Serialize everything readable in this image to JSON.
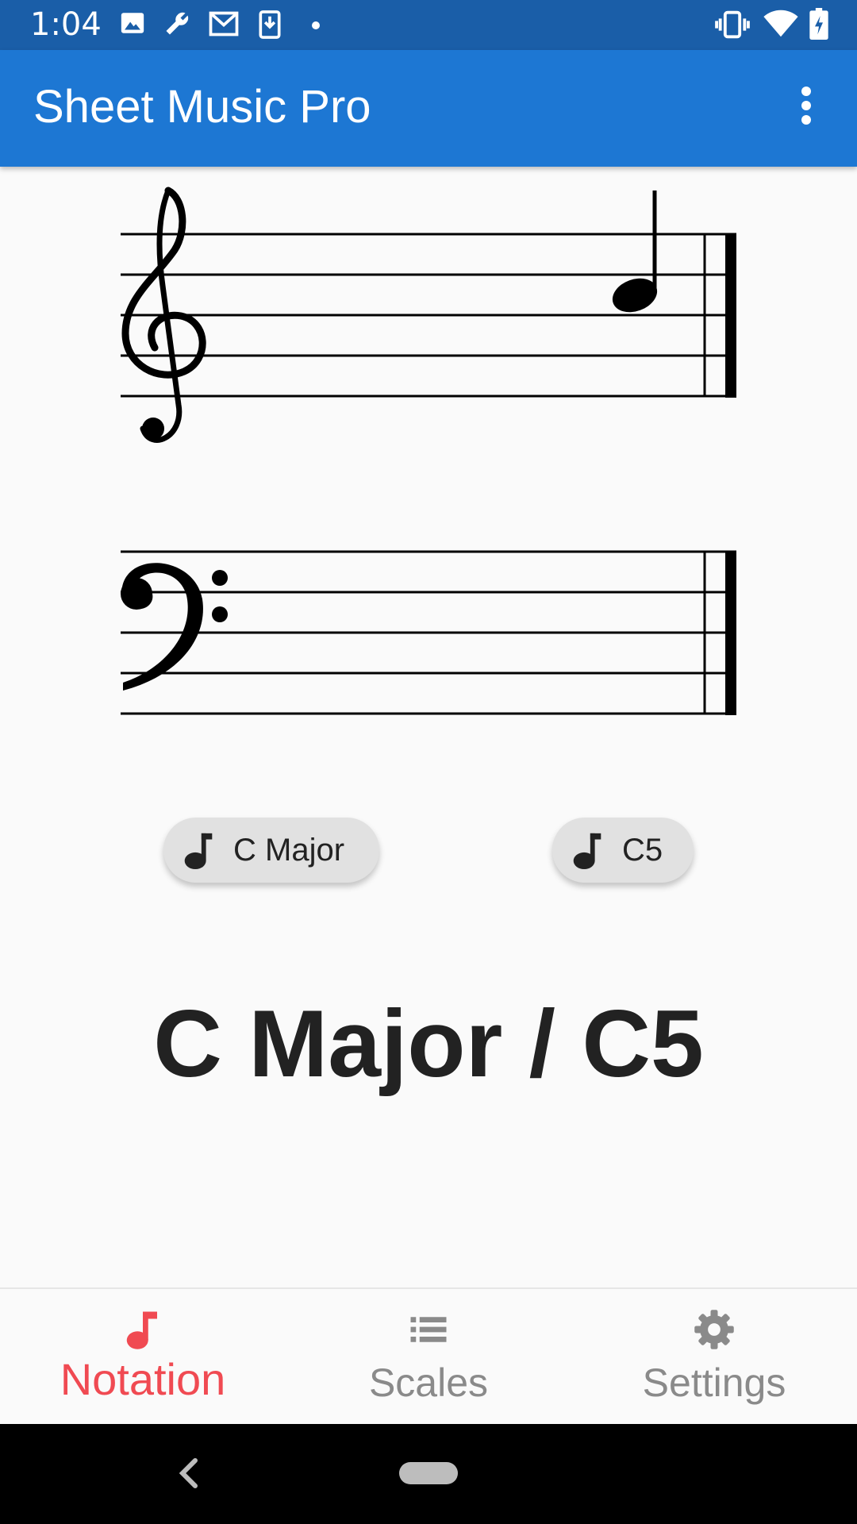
{
  "status_bar": {
    "time": "1:04",
    "left_icons": [
      "image-icon",
      "wrench-icon",
      "gmail-icon",
      "download-icon",
      "dot-icon"
    ],
    "right_icons": [
      "vibrate-icon",
      "wifi-icon",
      "battery-charging-icon"
    ]
  },
  "app_bar": {
    "title": "Sheet Music Pro",
    "menu_icon": "more-vert-icon"
  },
  "staff": {
    "treble_clef": "treble-clef-icon",
    "bass_clef": "bass-clef-icon",
    "note": "C5"
  },
  "chips": {
    "key": {
      "label": "C Major",
      "icon": "music-note-icon"
    },
    "note": {
      "label": "C5",
      "icon": "music-note-icon"
    }
  },
  "selection": {
    "text": "C Major / C5"
  },
  "bottom_nav": {
    "items": [
      {
        "label": "Notation",
        "icon": "music-note-icon",
        "active": true
      },
      {
        "label": "Scales",
        "icon": "list-icon",
        "active": false
      },
      {
        "label": "Settings",
        "icon": "gear-icon",
        "active": false
      }
    ]
  },
  "colors": {
    "status_bar": "#1a5ea8",
    "app_bar": "#1d77d3",
    "active_tab": "#f04a52",
    "inactive_tab": "#8a8a8a"
  }
}
